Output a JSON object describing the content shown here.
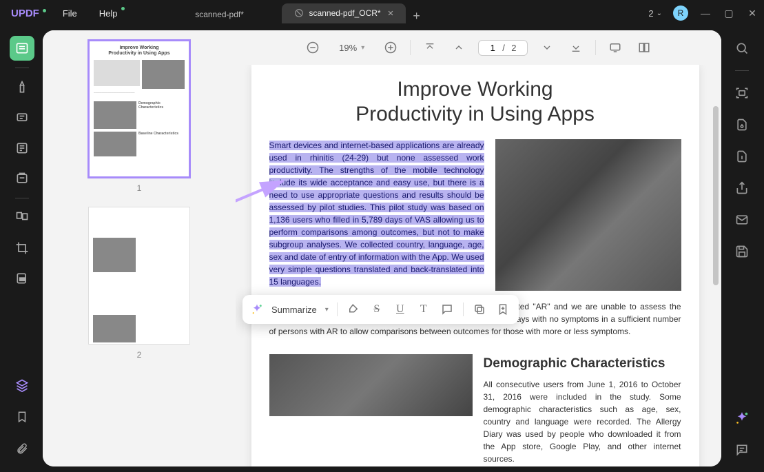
{
  "brand": "UPDF",
  "menu": {
    "file": "File",
    "help": "Help"
  },
  "tabs": [
    {
      "label": "scanned-pdf*",
      "active": false
    },
    {
      "label": "scanned-pdf_OCR*",
      "active": true
    }
  ],
  "newTab": "+",
  "topRight": {
    "indicator": "2",
    "avatar_letter": "R"
  },
  "toolbar": {
    "zoom": "19%",
    "page_current": "1",
    "page_sep": "/",
    "page_total": "2"
  },
  "thumbnails": [
    {
      "label": "1"
    },
    {
      "label": "2"
    }
  ],
  "doc": {
    "title_line1": "Improve Working",
    "title_line2": "Productivity in Using Apps",
    "highlighted": "Smart devices and internet-based applications are already used in rhinitis (24-29) but none assessed work productivity. The strengths of the mobile technology include its wide acceptance and easy use, but there is a need to use appropriate questions and results should be assessed by pilot studies. This pilot study was based on 1,136 users who filled in 5,789 days of VAS allowing us to perform comparisons among outcomes, but not to make subgroup analyses. We collected country, language, age, sex and date of entry of information with the App. We used very simple questions translated and back-translated into 15 languages.",
    "para2_tail": "was not a clinical trial. Thus, as expected, over 98% users reported \"AR\" and we are unable to assess the responses of \"non AR\" users. On the other hand, there are many days with no symptoms in a sufficient number of persons with AR to allow comparisons between outcomes for those with more or less symptoms.",
    "h2": "Demographic Characteristics",
    "para3": "All consecutive users from June 1, 2016 to October 31, 2016 were included in the study. Some demographic characteristics such as age, sex, country and language were recorded. The Allergy Diary was used by people who downloaded it from the App store, Google Play, and other internet sources."
  },
  "ctx": {
    "summarize": "Summarize"
  }
}
